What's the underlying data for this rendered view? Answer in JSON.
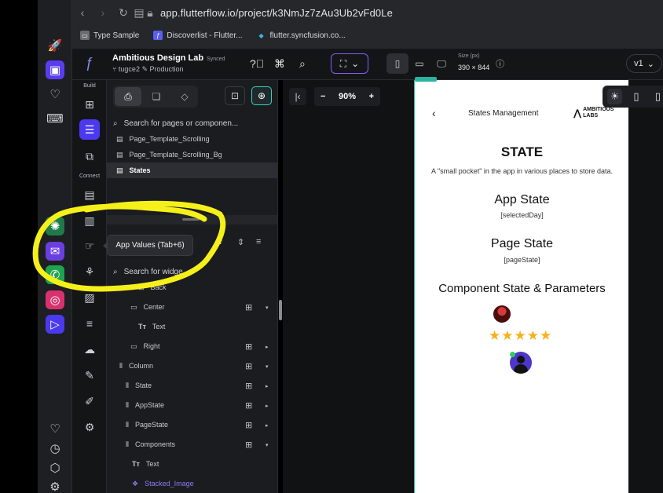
{
  "browser": {
    "url": "app.flutterflow.io/project/k3NmJz7zAu3Ub2vFd0Le",
    "bookmarks": [
      {
        "label": "Type Sample",
        "icon": "doc-icon",
        "color": "#6b6c72"
      },
      {
        "label": "Discoverlist - Flutter...",
        "icon": "flutterflow-icon",
        "color": "#5b5ef0"
      },
      {
        "label": "flutter.syncfusion.co...",
        "icon": "flutter-icon",
        "color": "#38b6e8"
      }
    ]
  },
  "app_bar": {
    "project_name": "Ambitious Design Lab",
    "synced_label": "Synced",
    "branch": "tugce2",
    "environment": "Production",
    "size_label": "Size (px)",
    "size_value": "390 × 844",
    "version": "v1",
    "accent_color": "#8a5cf5"
  },
  "rail": {
    "section_build": "Build",
    "section_connect": "Connect",
    "active_color": "#4b39ef"
  },
  "panel": {
    "pages_search_placeholder": "Search for pages or componen...",
    "pages": [
      {
        "label": "Page_Template_Scrolling",
        "selected": false
      },
      {
        "label": "Page_Template_Scrolling_Bg",
        "selected": false
      },
      {
        "label": "States",
        "selected": true
      }
    ],
    "widgets_search_placeholder": "Search for widge...",
    "tree": [
      {
        "label": "Back",
        "icon": "button-icon"
      },
      {
        "label": "Center",
        "icon": "row-icon"
      },
      {
        "label": "Text",
        "icon": "text-icon"
      },
      {
        "label": "Right",
        "icon": "row-icon"
      },
      {
        "label": "Column",
        "icon": "column-icon"
      },
      {
        "label": "State",
        "icon": "column-icon"
      },
      {
        "label": "AppState",
        "icon": "column-icon"
      },
      {
        "label": "PageState",
        "icon": "column-icon"
      },
      {
        "label": "Components",
        "icon": "column-icon"
      },
      {
        "label": "Text",
        "icon": "text-icon"
      },
      {
        "label": "Stacked_Image",
        "icon": "component-icon"
      }
    ]
  },
  "tooltip": {
    "text": "App Values (Tab+6)"
  },
  "canvas": {
    "zoom": "90%",
    "phone_title": "States Management",
    "brand": "AMBITIOUS LABS",
    "heading": "STATE",
    "description": "A \"small pocket\" in the app in various places to store data.",
    "app_state_title": "App State",
    "app_state_var": "[selectedDay]",
    "page_state_title": "Page State",
    "page_state_var": "[pageState]",
    "component_title": "Component State & Parameters",
    "rating_stars": "★★★★★",
    "rating_value": 5,
    "star_color": "#f5b21c"
  },
  "highlight_color": "#f6f01a"
}
